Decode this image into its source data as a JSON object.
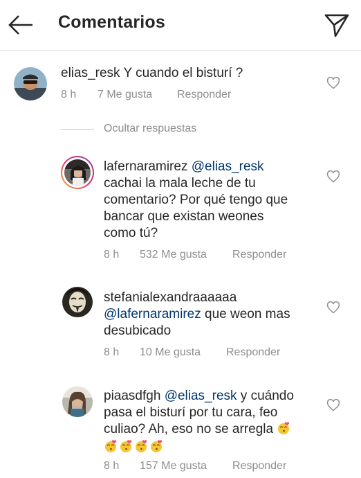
{
  "header": {
    "title": "Comentarios",
    "back_icon": "back-arrow-icon",
    "share_icon": "send-icon"
  },
  "hide_replies": "Ocultar respuestas",
  "comments": [
    {
      "username": "elias_resk",
      "text": "Y cuando el bisturí ?",
      "time": "8 h",
      "likes": "7 Me gusta",
      "reply": "Responder"
    },
    {
      "username": "lafernaramirez",
      "mention": "@elias_resk",
      "line1": "cachai la mala leche de tu",
      "line2": "comentario? Por qué tengo que",
      "line3": "bancar que existan weones",
      "line4": "como tú?",
      "time": "8 h",
      "likes": "532 Me gusta",
      "reply": "Responder"
    },
    {
      "username": "stefanialexandraaaaaa",
      "mention": "@lafernaramirez",
      "text_after_mention": " que weon mas",
      "line2": "desubicado",
      "time": "8 h",
      "likes": "10 Me gusta",
      "reply": "Responder"
    },
    {
      "username": "piaasdfgh",
      "mention": "@elias_resk",
      "text_after_mention": " y cuándo",
      "line2": "pasa el bisturí por tu cara, feo",
      "line3": "culiao? Ah, eso no se arregla",
      "emoji_name": "kissing-face-with-hearts-icon",
      "time": "8 h",
      "likes": "157 Me gusta",
      "reply": "Responder"
    }
  ],
  "colors": {
    "text": "#262626",
    "secondary": "#8e8e8e",
    "mention": "#00376b",
    "divider": "#dbdbdb"
  }
}
